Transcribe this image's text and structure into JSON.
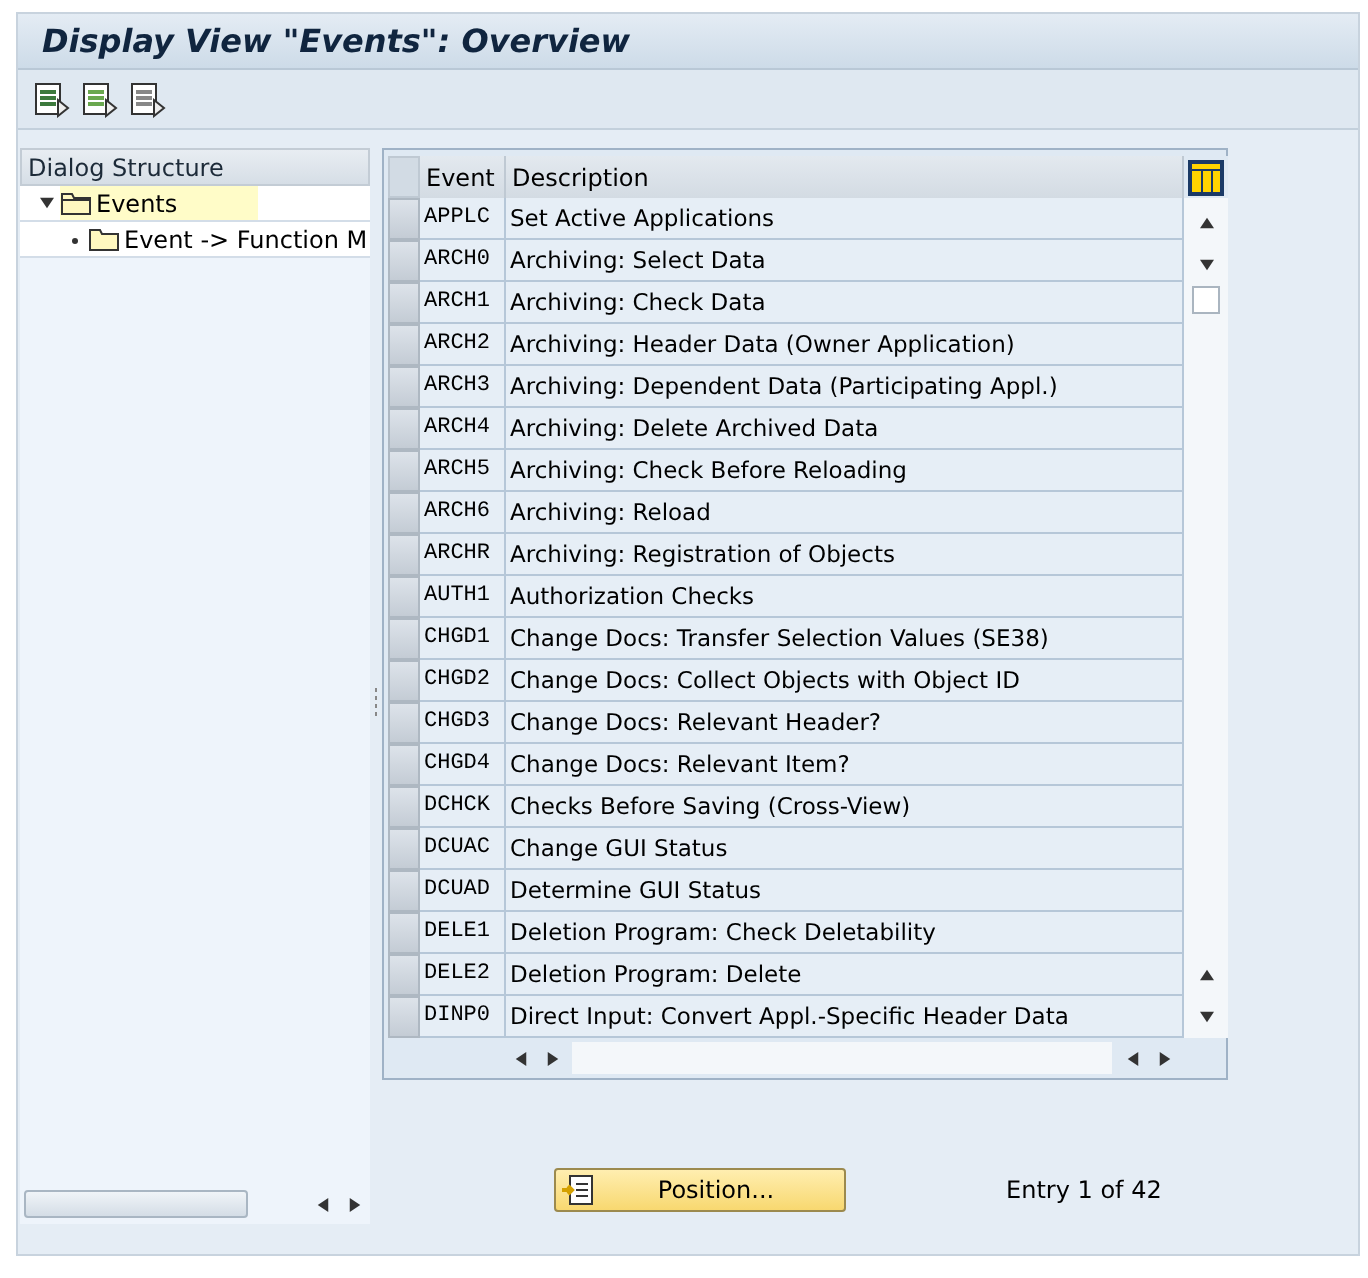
{
  "window": {
    "title": "Display View \"Events\": Overview"
  },
  "toolbar": {
    "buttons": [
      {
        "kind": "list"
      },
      {
        "kind": "select"
      },
      {
        "kind": "deselect"
      }
    ]
  },
  "dialog_structure": {
    "title": "Dialog Structure",
    "items": [
      {
        "label": "Events",
        "selected": true,
        "expanded": true,
        "children": [
          {
            "label": "Event -> Function M",
            "selected": false
          }
        ]
      }
    ]
  },
  "table": {
    "columns": [
      "Event",
      "Description"
    ],
    "rows": [
      {
        "event": "APPLC",
        "description": "Set Active Applications"
      },
      {
        "event": "ARCH0",
        "description": "Archiving: Select Data"
      },
      {
        "event": "ARCH1",
        "description": "Archiving: Check Data"
      },
      {
        "event": "ARCH2",
        "description": "Archiving: Header Data (Owner Application)"
      },
      {
        "event": "ARCH3",
        "description": "Archiving: Dependent Data (Participating Appl.)"
      },
      {
        "event": "ARCH4",
        "description": "Archiving: Delete Archived Data"
      },
      {
        "event": "ARCH5",
        "description": "Archiving: Check Before Reloading"
      },
      {
        "event": "ARCH6",
        "description": "Archiving: Reload"
      },
      {
        "event": "ARCHR",
        "description": "Archiving: Registration of Objects"
      },
      {
        "event": "AUTH1",
        "description": "Authorization Checks"
      },
      {
        "event": "CHGD1",
        "description": "Change Docs: Transfer Selection Values (SE38)"
      },
      {
        "event": "CHGD2",
        "description": "Change Docs: Collect Objects with Object ID"
      },
      {
        "event": "CHGD3",
        "description": "Change Docs: Relevant Header?"
      },
      {
        "event": "CHGD4",
        "description": "Change Docs: Relevant Item?"
      },
      {
        "event": "DCHCK",
        "description": "Checks Before Saving (Cross-View)"
      },
      {
        "event": "DCUAC",
        "description": "Change GUI Status"
      },
      {
        "event": "DCUAD",
        "description": "Determine GUI Status"
      },
      {
        "event": "DELE1",
        "description": "Deletion Program: Check Deletability"
      },
      {
        "event": "DELE2",
        "description": "Deletion Program: Delete"
      },
      {
        "event": "DINP0",
        "description": "Direct Input: Convert Appl.-Specific Header Data"
      }
    ]
  },
  "position_button": {
    "label": "Position..."
  },
  "entry_info": "Entry 1 of 42"
}
